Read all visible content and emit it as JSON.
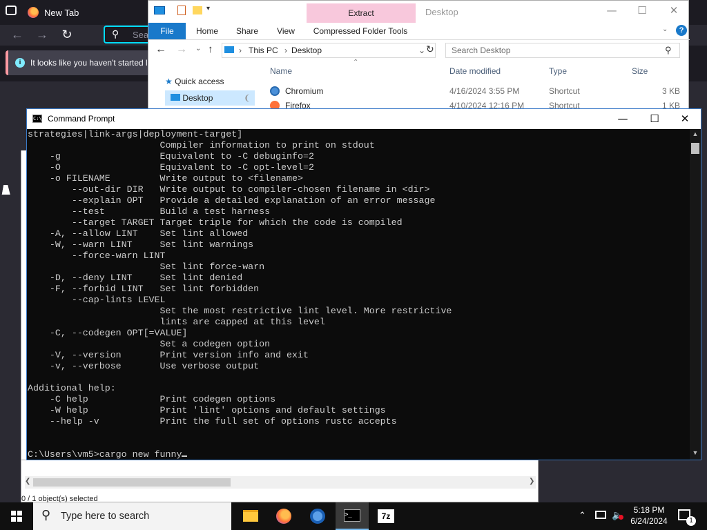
{
  "firefox": {
    "tab_title": "New Tab",
    "search_placeholder": "Search",
    "notice_text": "It looks like you haven't started l"
  },
  "explorer": {
    "context_tab": "Extract",
    "window_title": "Desktop",
    "ribbon_tabs": [
      "File",
      "Home",
      "Share",
      "View",
      "Compressed Folder Tools"
    ],
    "address": [
      "This PC",
      "Desktop"
    ],
    "search_placeholder": "Search Desktop",
    "nav": [
      {
        "label": "Quick access"
      },
      {
        "label": "Desktop"
      }
    ],
    "columns": [
      "Name",
      "Date modified",
      "Type",
      "Size"
    ],
    "files": [
      {
        "name": "Chromium",
        "date": "4/16/2024 3:55 PM",
        "type": "Shortcut",
        "size": "3 KB"
      },
      {
        "name": "Firefox",
        "date": "4/10/2024 12:16 PM",
        "type": "Shortcut",
        "size": "1 KB"
      }
    ],
    "status": "0 / 1 object(s) selected"
  },
  "cmd": {
    "title": "Command Prompt",
    "lines": [
      "strategies|link-args|deployment-target]",
      "                        Compiler information to print on stdout",
      "    -g                  Equivalent to -C debuginfo=2",
      "    -O                  Equivalent to -C opt-level=2",
      "    -o FILENAME         Write output to <filename>",
      "        --out-dir DIR   Write output to compiler-chosen filename in <dir>",
      "        --explain OPT   Provide a detailed explanation of an error message",
      "        --test          Build a test harness",
      "        --target TARGET Target triple for which the code is compiled",
      "    -A, --allow LINT    Set lint allowed",
      "    -W, --warn LINT     Set lint warnings",
      "        --force-warn LINT",
      "                        Set lint force-warn",
      "    -D, --deny LINT     Set lint denied",
      "    -F, --forbid LINT   Set lint forbidden",
      "        --cap-lints LEVEL",
      "                        Set the most restrictive lint level. More restrictive",
      "                        lints are capped at this level",
      "    -C, --codegen OPT[=VALUE]",
      "                        Set a codegen option",
      "    -V, --version       Print version info and exit",
      "    -v, --verbose       Use verbose output",
      "",
      "Additional help:",
      "    -C help             Print codegen options",
      "    -W help             Print 'lint' options and default settings",
      "    --help -v           Print the full set of options rustc accepts",
      "",
      "",
      "C:\\Users\\vm5>cargo new funny"
    ]
  },
  "taskbar": {
    "search_placeholder": "Type here to search",
    "apps": [
      "file-explorer",
      "firefox",
      "chromium",
      "command-prompt",
      "7-zip"
    ],
    "time": "5:18 PM",
    "date": "6/24/2024",
    "notification_count": "1"
  }
}
